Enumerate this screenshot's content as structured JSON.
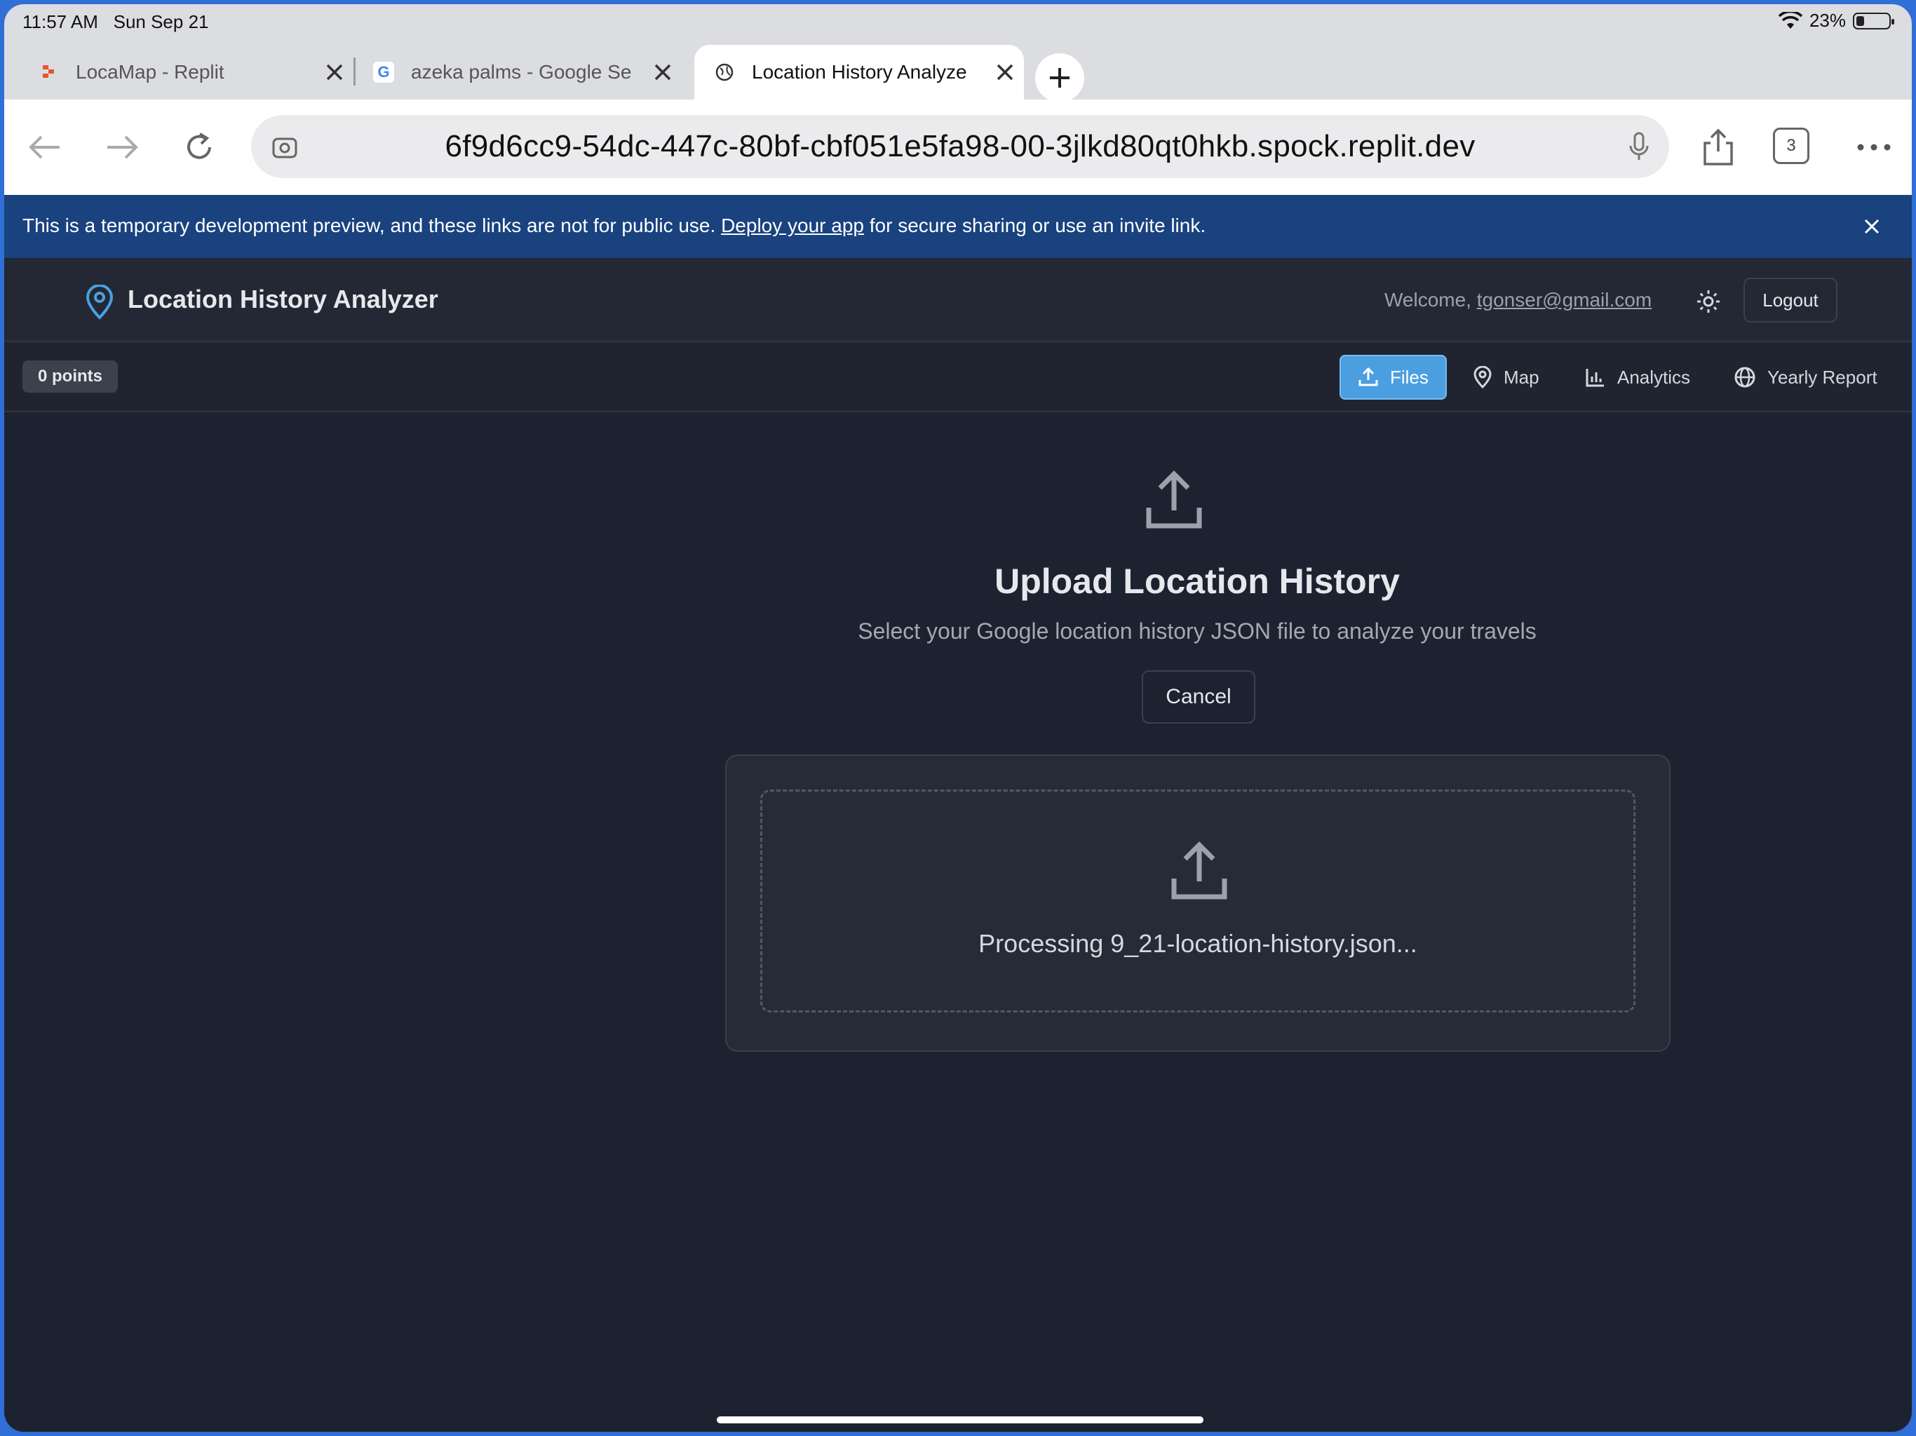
{
  "status": {
    "time": "11:57 AM",
    "date": "Sun Sep 21",
    "battery": "23%"
  },
  "tabs": [
    {
      "label": "LocaMap - Replit",
      "icon": "replit-icon"
    },
    {
      "label": "azeka palms - Google Se",
      "icon": "google-icon"
    },
    {
      "label": "Location History Analyze",
      "icon": "globe-icon"
    }
  ],
  "toolbar": {
    "url": "6f9d6cc9-54dc-447c-80bf-cbf051e5fa98-00-3jlkd80qt0hkb.spock.replit.dev",
    "tab_count": "3"
  },
  "banner": {
    "text_before": "This is a temporary development preview, and these links are not for public use. ",
    "link": "Deploy your app",
    "text_after": " for secure sharing or use an invite link."
  },
  "app": {
    "title": "Location History Analyzer",
    "welcome": "Welcome, ",
    "email": "tgonser@gmail.com",
    "logout": "Logout",
    "points": "0 points",
    "nav": {
      "files": "Files",
      "map": "Map",
      "analytics": "Analytics",
      "yearly": "Yearly Report"
    }
  },
  "upload": {
    "title": "Upload Location History",
    "subtitle": "Select your Google location history JSON file to analyze your travels",
    "cancel": "Cancel",
    "processing": "Processing 9_21-location-history.json..."
  },
  "colors": {
    "accent": "#4b9fe0",
    "banner": "#19427f",
    "background": "#1d2230"
  }
}
